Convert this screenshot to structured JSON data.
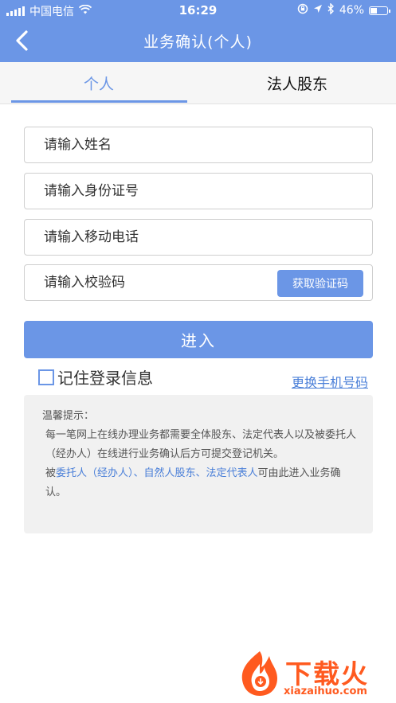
{
  "status_bar": {
    "carrier": "中国电信",
    "time": "16:29",
    "battery": "46%",
    "battery_level": 0.46
  },
  "nav": {
    "title": "业务确认(个人)"
  },
  "tabs": [
    {
      "label": "个人",
      "active": true
    },
    {
      "label": "法人股东",
      "active": false
    }
  ],
  "form": {
    "name_placeholder": "请输入姓名",
    "id_placeholder": "请输入身份证号",
    "phone_placeholder": "请输入移动电话",
    "code_placeholder": "请输入校验码",
    "get_code_label": "获取验证码",
    "submit_label": "进入",
    "remember_label": "记住登录信息",
    "change_phone_label": "更换手机号码"
  },
  "tips": {
    "title": "温馨提示：",
    "line1": "每一笔网上在线办理业务都需要全体股东、法定代表人以及被委托人（经办人）在线进行业务确认后方可提交登记机关。",
    "line2_prefix": "被",
    "line2_link": "委托人（经办人）、自然人股东、法定代表人",
    "line2_suffix": "可由此进入业务确认。"
  },
  "watermark": {
    "text": "下载火",
    "url": "xiazaihuo.com"
  },
  "colors": {
    "accent": "#6b96e6",
    "link": "#4a7fd8",
    "watermark": "#ff5a1f"
  }
}
